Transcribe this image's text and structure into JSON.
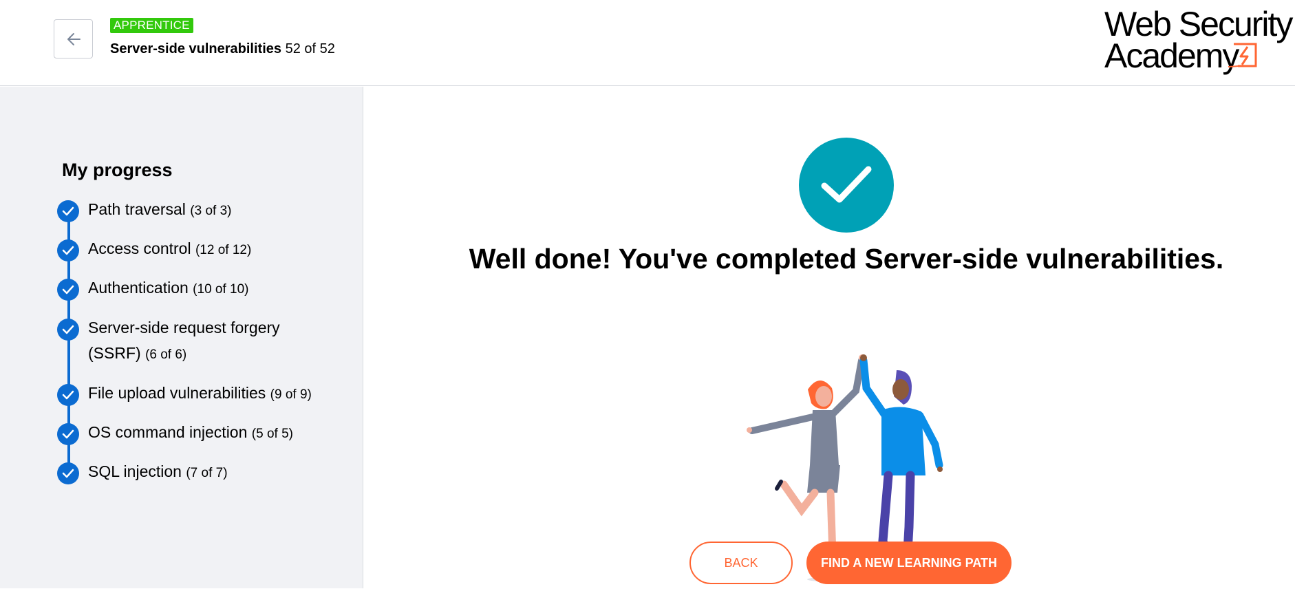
{
  "header": {
    "back_icon": "arrow-left-icon",
    "level_badge": "APPRENTICE",
    "path_name": "Server-side vulnerabilities",
    "path_position": "52 of 52",
    "logo_line1": "Web Security",
    "logo_line2": "Academy",
    "logo_icon": "lightning-square-icon"
  },
  "sidebar": {
    "title": "My progress",
    "items": [
      {
        "label": "Path traversal",
        "count": "(3 of 3)"
      },
      {
        "label": "Access control",
        "count": "(12 of 12)"
      },
      {
        "label": "Authentication",
        "count": "(10 of 10)"
      },
      {
        "label": "Server-side request forgery (SSRF)",
        "count": "(6 of 6)"
      },
      {
        "label": "File upload vulnerabilities",
        "count": "(9 of 9)"
      },
      {
        "label": "OS command injection",
        "count": "(5 of 5)"
      },
      {
        "label": "SQL injection",
        "count": "(7 of 7)"
      }
    ]
  },
  "main": {
    "success_icon": "checkmark-icon",
    "headline": "Well done! You've completed Server-side vulnerabilities.",
    "illustration": "high-five-illustration",
    "back_button": "BACK",
    "find_button": "FIND A NEW LEARNING PATH"
  },
  "colors": {
    "accent_orange": "#ff6633",
    "progress_blue": "#0b6bd1",
    "success_teal": "#00a1b6",
    "badge_green": "#32c90c",
    "sidebar_bg": "#f1f2f5"
  }
}
